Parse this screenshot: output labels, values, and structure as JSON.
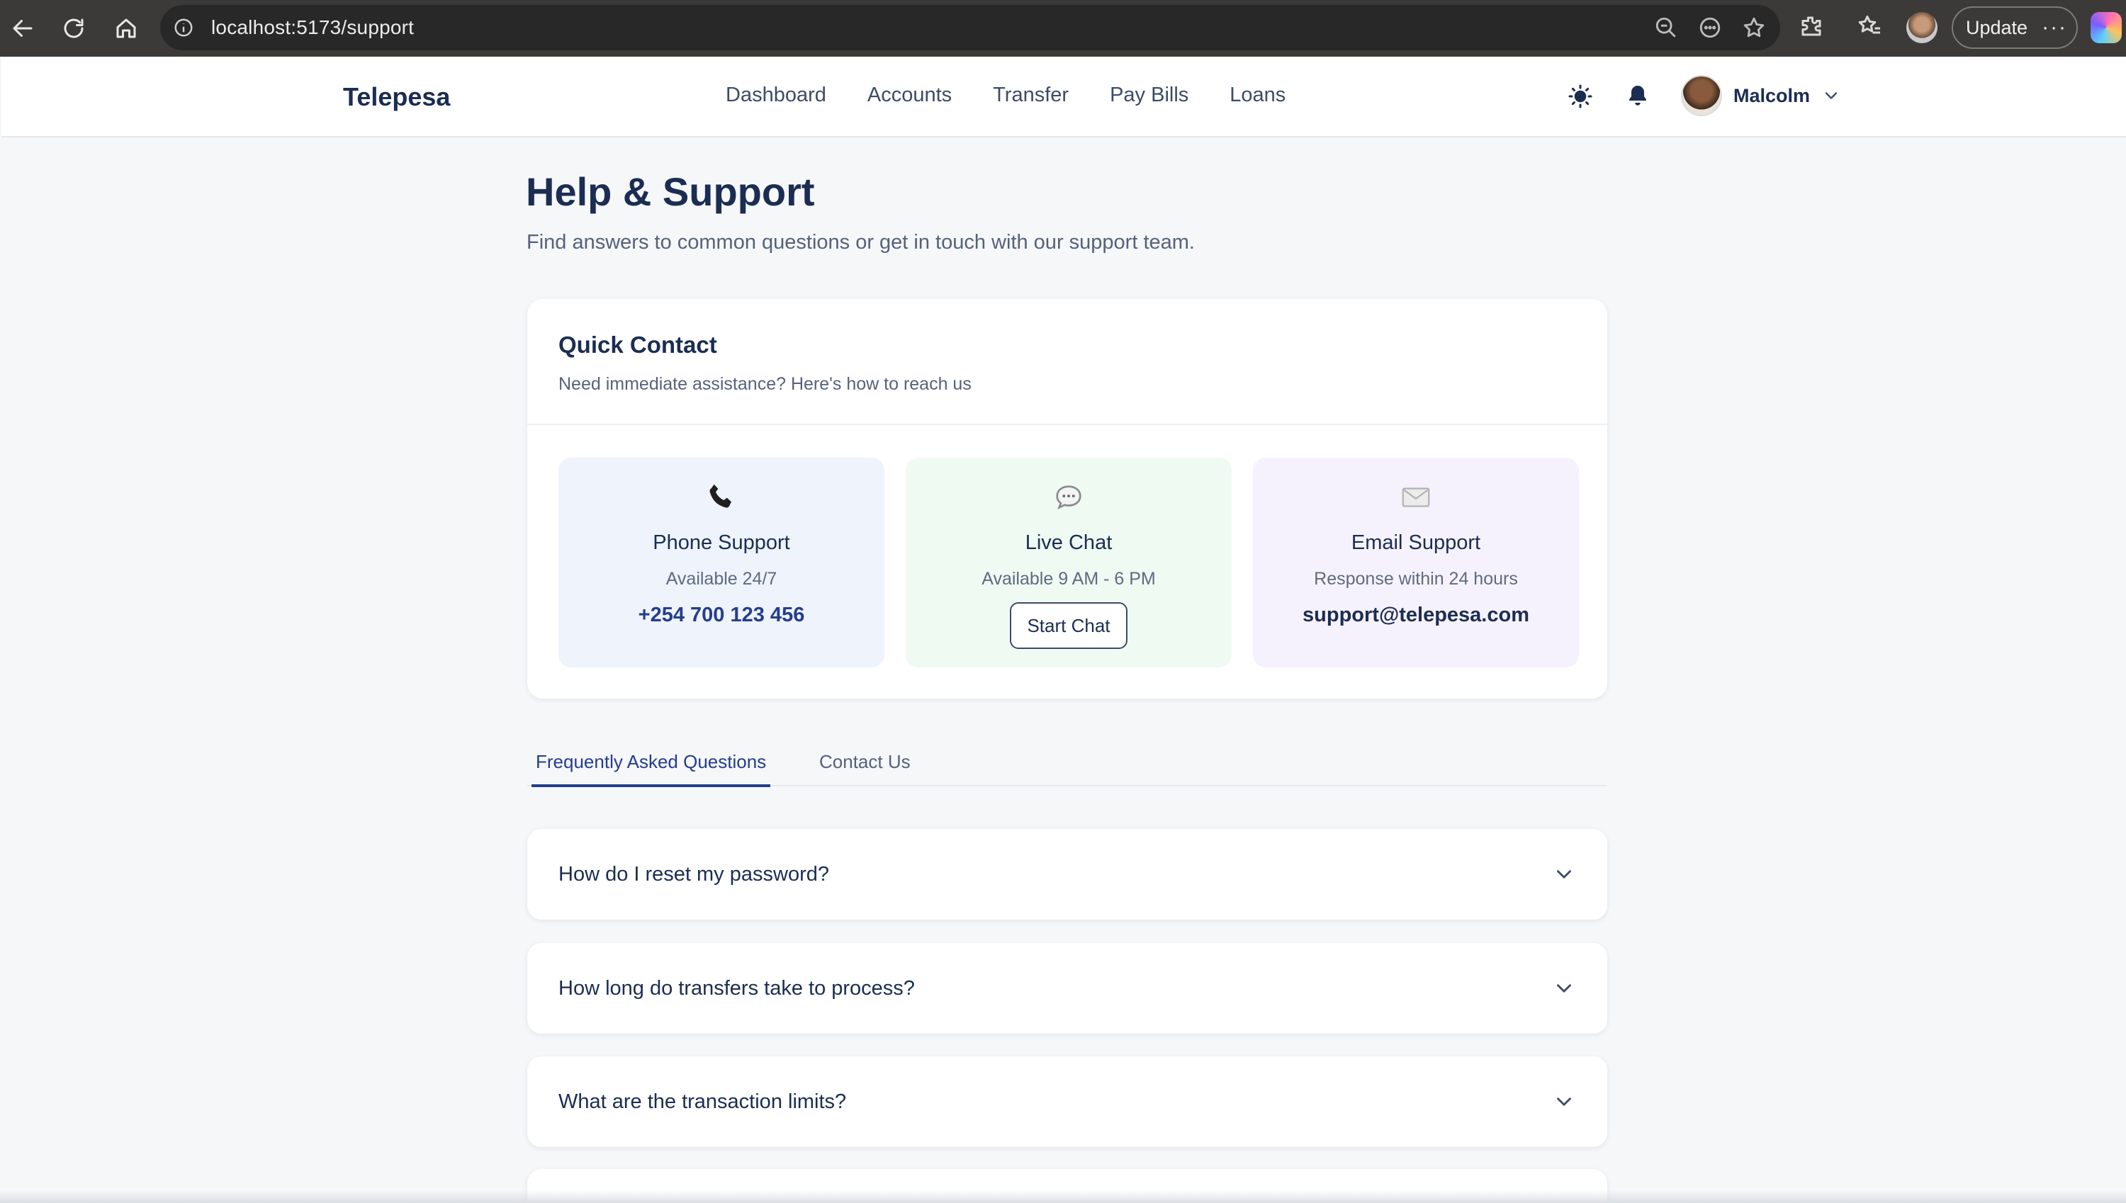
{
  "browser": {
    "url": "localhost:5173/support",
    "update_label": "Update",
    "more_label": "···"
  },
  "header": {
    "brand": "Telepesa",
    "nav": [
      "Dashboard",
      "Accounts",
      "Transfer",
      "Pay Bills",
      "Loans"
    ],
    "user_name": "Malcolm"
  },
  "page": {
    "title": "Help & Support",
    "subtitle": "Find answers to common questions or get in touch with our support team."
  },
  "quick_contact": {
    "title": "Quick Contact",
    "subtitle": "Need immediate assistance? Here's how to reach us",
    "phone": {
      "title": "Phone Support",
      "availability": "Available 24/7",
      "value": "+254 700 123 456",
      "icon": "phone-icon"
    },
    "chat": {
      "title": "Live Chat",
      "availability": "Available 9 AM - 6 PM",
      "button": "Start Chat",
      "icon": "chat-bubble-icon"
    },
    "email": {
      "title": "Email Support",
      "availability": "Response within 24 hours",
      "value": "support@telepesa.com",
      "icon": "envelope-icon"
    }
  },
  "tabs": {
    "faq": "Frequently Asked Questions",
    "contact": "Contact Us",
    "active": "faq"
  },
  "faqs": [
    "How do I reset my password?",
    "How long do transfers take to process?",
    "What are the transaction limits?"
  ],
  "colors": {
    "brand": "#1b2d52",
    "accent": "#253d8c",
    "phone_tile": "#eef3fc",
    "chat_tile": "#effaf3",
    "email_tile": "#f6f2fd"
  }
}
